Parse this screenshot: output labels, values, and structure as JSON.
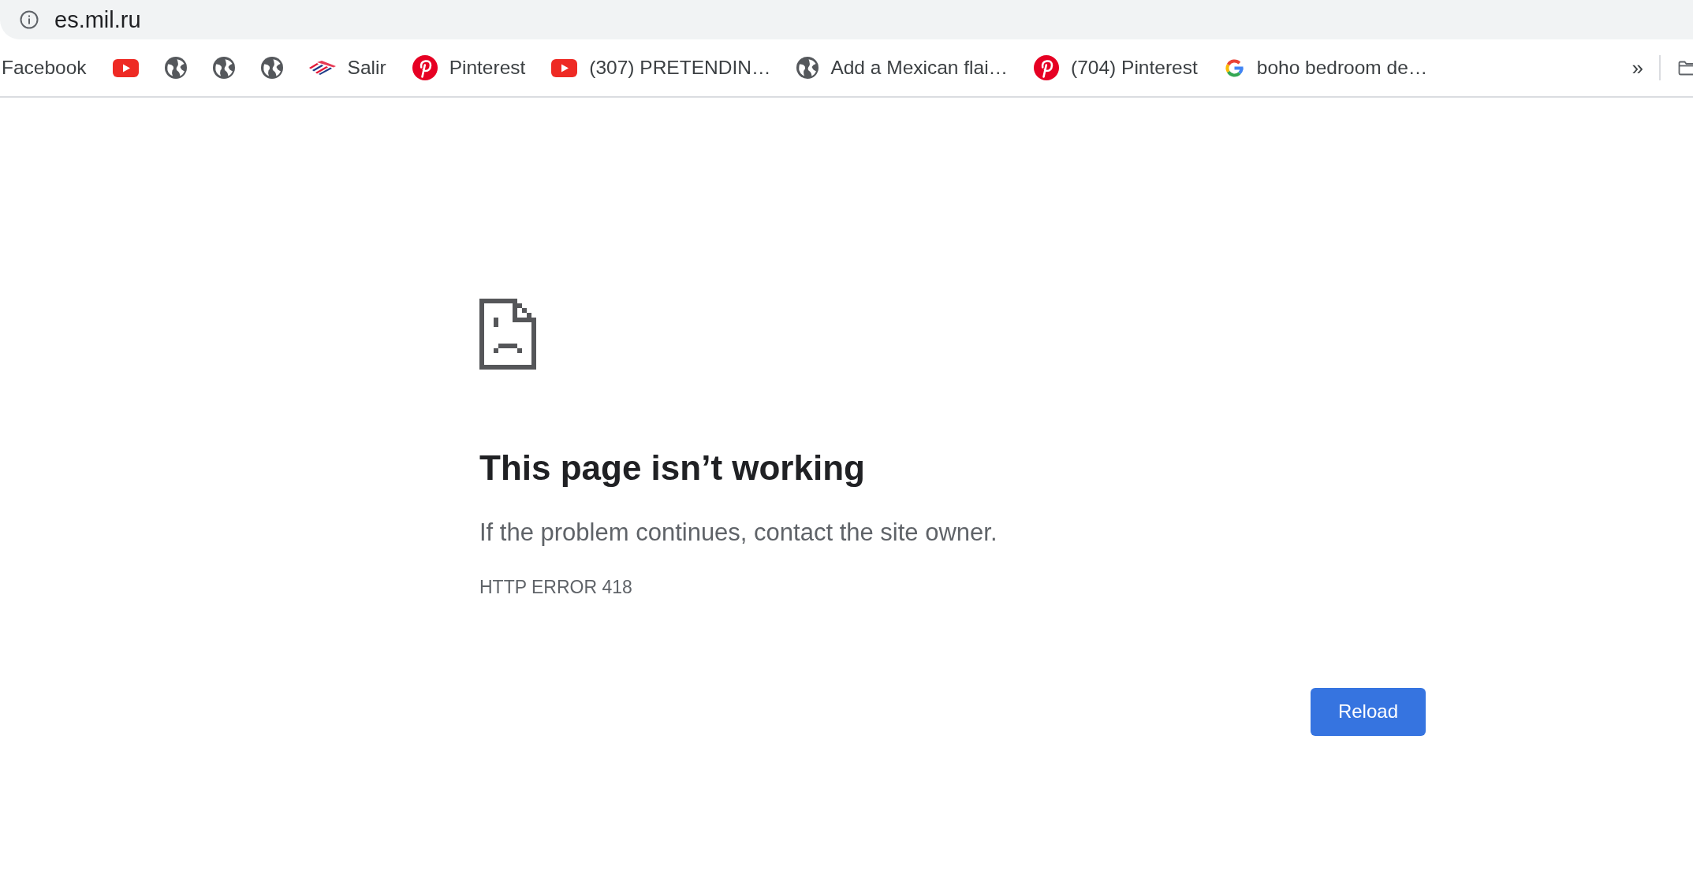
{
  "address_bar": {
    "url": "es.mil.ru"
  },
  "bookmarks_bar": {
    "items": [
      {
        "kind": "text",
        "label": "Facebook"
      },
      {
        "kind": "play"
      },
      {
        "kind": "globe"
      },
      {
        "kind": "globe"
      },
      {
        "kind": "globe"
      },
      {
        "kind": "flag",
        "label": "Salir"
      },
      {
        "kind": "pin",
        "label": "Pinterest"
      },
      {
        "kind": "play",
        "label": "(307) PRETENDIN…"
      },
      {
        "kind": "globe",
        "label": "Add a Mexican flai…"
      },
      {
        "kind": "pin",
        "label": "(704) Pinterest"
      },
      {
        "kind": "g_logo",
        "label": "boho bedroom de…"
      }
    ],
    "overflow_button": "»"
  },
  "error_page": {
    "heading": "This page isn’t working",
    "message": "If the problem continues, contact the site owner.",
    "error_code": "HTTP ERROR 418",
    "reload_button": "Reload"
  }
}
